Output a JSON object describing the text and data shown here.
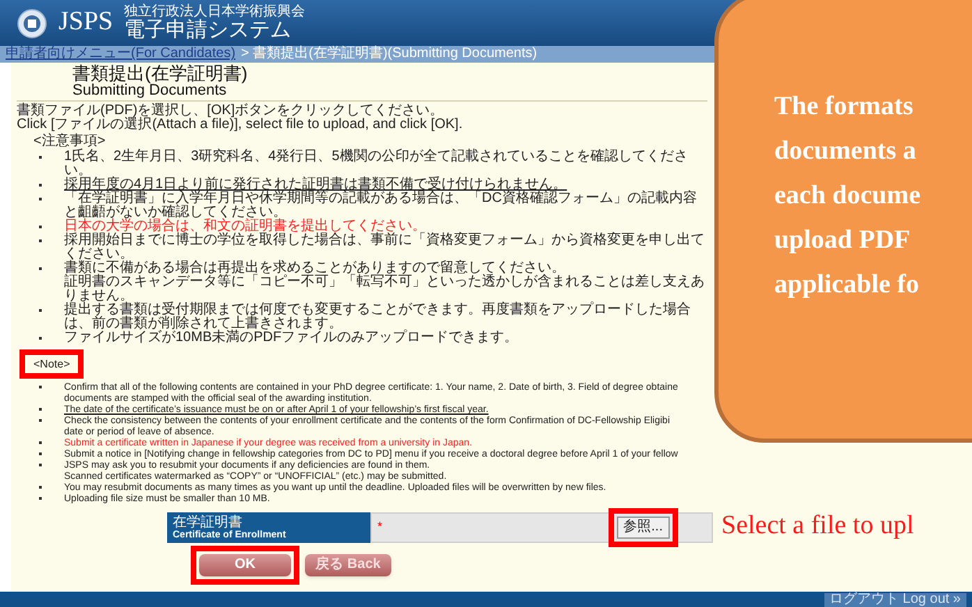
{
  "header": {
    "logo_text": "JSPS",
    "org": "独立行政法人日本学術振興会",
    "system": "電子申請システム"
  },
  "breadcrumb": [
    {
      "label": "申請者向けメニュー(For Candidates)",
      "link": true
    },
    {
      "label": "> 書類提出(在学証明書)(Submitting Documents)",
      "link": false
    }
  ],
  "page_title": {
    "ja": "書類提出(在学証明書)",
    "en": "Submitting Documents"
  },
  "instructions": [
    "書類ファイル(PDF)を選択し、[OK]ボタンをクリックしてください。",
    "Click [ファイルの選択(Attach a file)], select file to upload, and click [OK]."
  ],
  "notes_ja": {
    "heading": "<注意事項>",
    "highlighted": false,
    "items": [
      {
        "text": "1氏名、2生年月日、3研究科名、4発行日、5機関の公印が全て記載されていることを確認してください。",
        "bullet": true,
        "kind": "plain"
      },
      {
        "text": "採用年度の4月1日より前に発行された証明書は書類不備で受け付けられません。",
        "bullet": true,
        "kind": "underline"
      },
      {
        "text": "「在学証明書」に入学年月日や休学期間等の記載がある場合は、「DC資格確認フォーム」の記載内容と齟齬がないか確認してください。",
        "bullet": true,
        "kind": "plain"
      },
      {
        "text": "日本の大学の場合は、和文の証明書を提出してください。",
        "bullet": true,
        "kind": "red"
      },
      {
        "text": "採用開始日までに博士の学位を取得した場合は、事前に「資格変更フォーム」から資格変更を申し出てください。",
        "bullet": true,
        "kind": "plain"
      },
      {
        "text": "書類に不備がある場合は再提出を求めることがありますので留意してください。",
        "bullet": true,
        "kind": "plain"
      },
      {
        "text": "証明書のスキャンデータ等に「コピー不可」「転写不可」といった透かしが含まれることは差し支えありません。",
        "bullet": false,
        "kind": "plain"
      },
      {
        "text": "提出する書類は受付期限までは何度でも変更することができます。再度書類をアップロードした場合は、前の書類が削除されて上書きされます。",
        "bullet": true,
        "kind": "plain"
      },
      {
        "text": "ファイルサイズが10MB未満のPDFファイルのみアップロードできます。",
        "bullet": true,
        "kind": "plain"
      }
    ]
  },
  "notes_en": {
    "heading": "<Note>",
    "highlighted": true,
    "items": [
      {
        "text": "Confirm that all of the following contents are contained in your PhD degree certificate: 1. Your name, 2. Date of birth, 3. Field of degree obtaine",
        "bullet": true,
        "kind": "plain"
      },
      {
        "text": "documents are stamped with the official seal of the awarding institution.",
        "bullet": false,
        "kind": "plain"
      },
      {
        "text": "The date of the certificate’s issuance must be on or after April 1 of your fellowship’s first fiscal year.",
        "bullet": true,
        "kind": "underline"
      },
      {
        "text": "Check the consistency between the contents of your enrollment certificate and the contents of the form Confirmation of DC-Fellowship Eligibi",
        "bullet": true,
        "kind": "plain"
      },
      {
        "text": "date or period of leave of absence.",
        "bullet": false,
        "kind": "plain"
      },
      {
        "text": "Submit a certificate written in Japanese if your degree was received from a university in Japan.",
        "bullet": true,
        "kind": "red"
      },
      {
        "text": "Submit a notice in [Notifying change in fellowship categories from DC to PD] menu if you receive a doctoral degree before April 1 of your fellow",
        "bullet": true,
        "kind": "plain"
      },
      {
        "text": "JSPS may ask you to resubmit your documents if any deficiencies are found in them.",
        "bullet": true,
        "kind": "plain"
      },
      {
        "text": "Scanned certificates watermarked as “COPY” or “UNOFFICIAL” (etc.) may be submitted.",
        "bullet": false,
        "kind": "plain"
      },
      {
        "text": "You may resubmit documents as many times as you want up until the deadline. Uploaded files will be overwritten by new files.",
        "bullet": true,
        "kind": "plain"
      },
      {
        "text": "Uploading file size must be smaller than 10 MB.",
        "bullet": true,
        "kind": "plain"
      }
    ]
  },
  "file_field": {
    "label_ja": "在学証明書",
    "label_en": "Certificate of Enrollment",
    "required_mark": "*",
    "browse": {
      "label": "参照...",
      "highlighted": true
    }
  },
  "buttons": [
    {
      "label": "OK",
      "kind": "primary",
      "highlighted": true
    },
    {
      "label": "戻る Back",
      "kind": "secondary",
      "highlighted": false
    }
  ],
  "footer": {
    "logout": "ログアウト Log out »"
  },
  "callout": {
    "lines": [
      "The formats",
      "documents a",
      "each docume",
      "upload PDF",
      "applicable fo"
    ]
  },
  "annotation_note": "Select a file to upl"
}
